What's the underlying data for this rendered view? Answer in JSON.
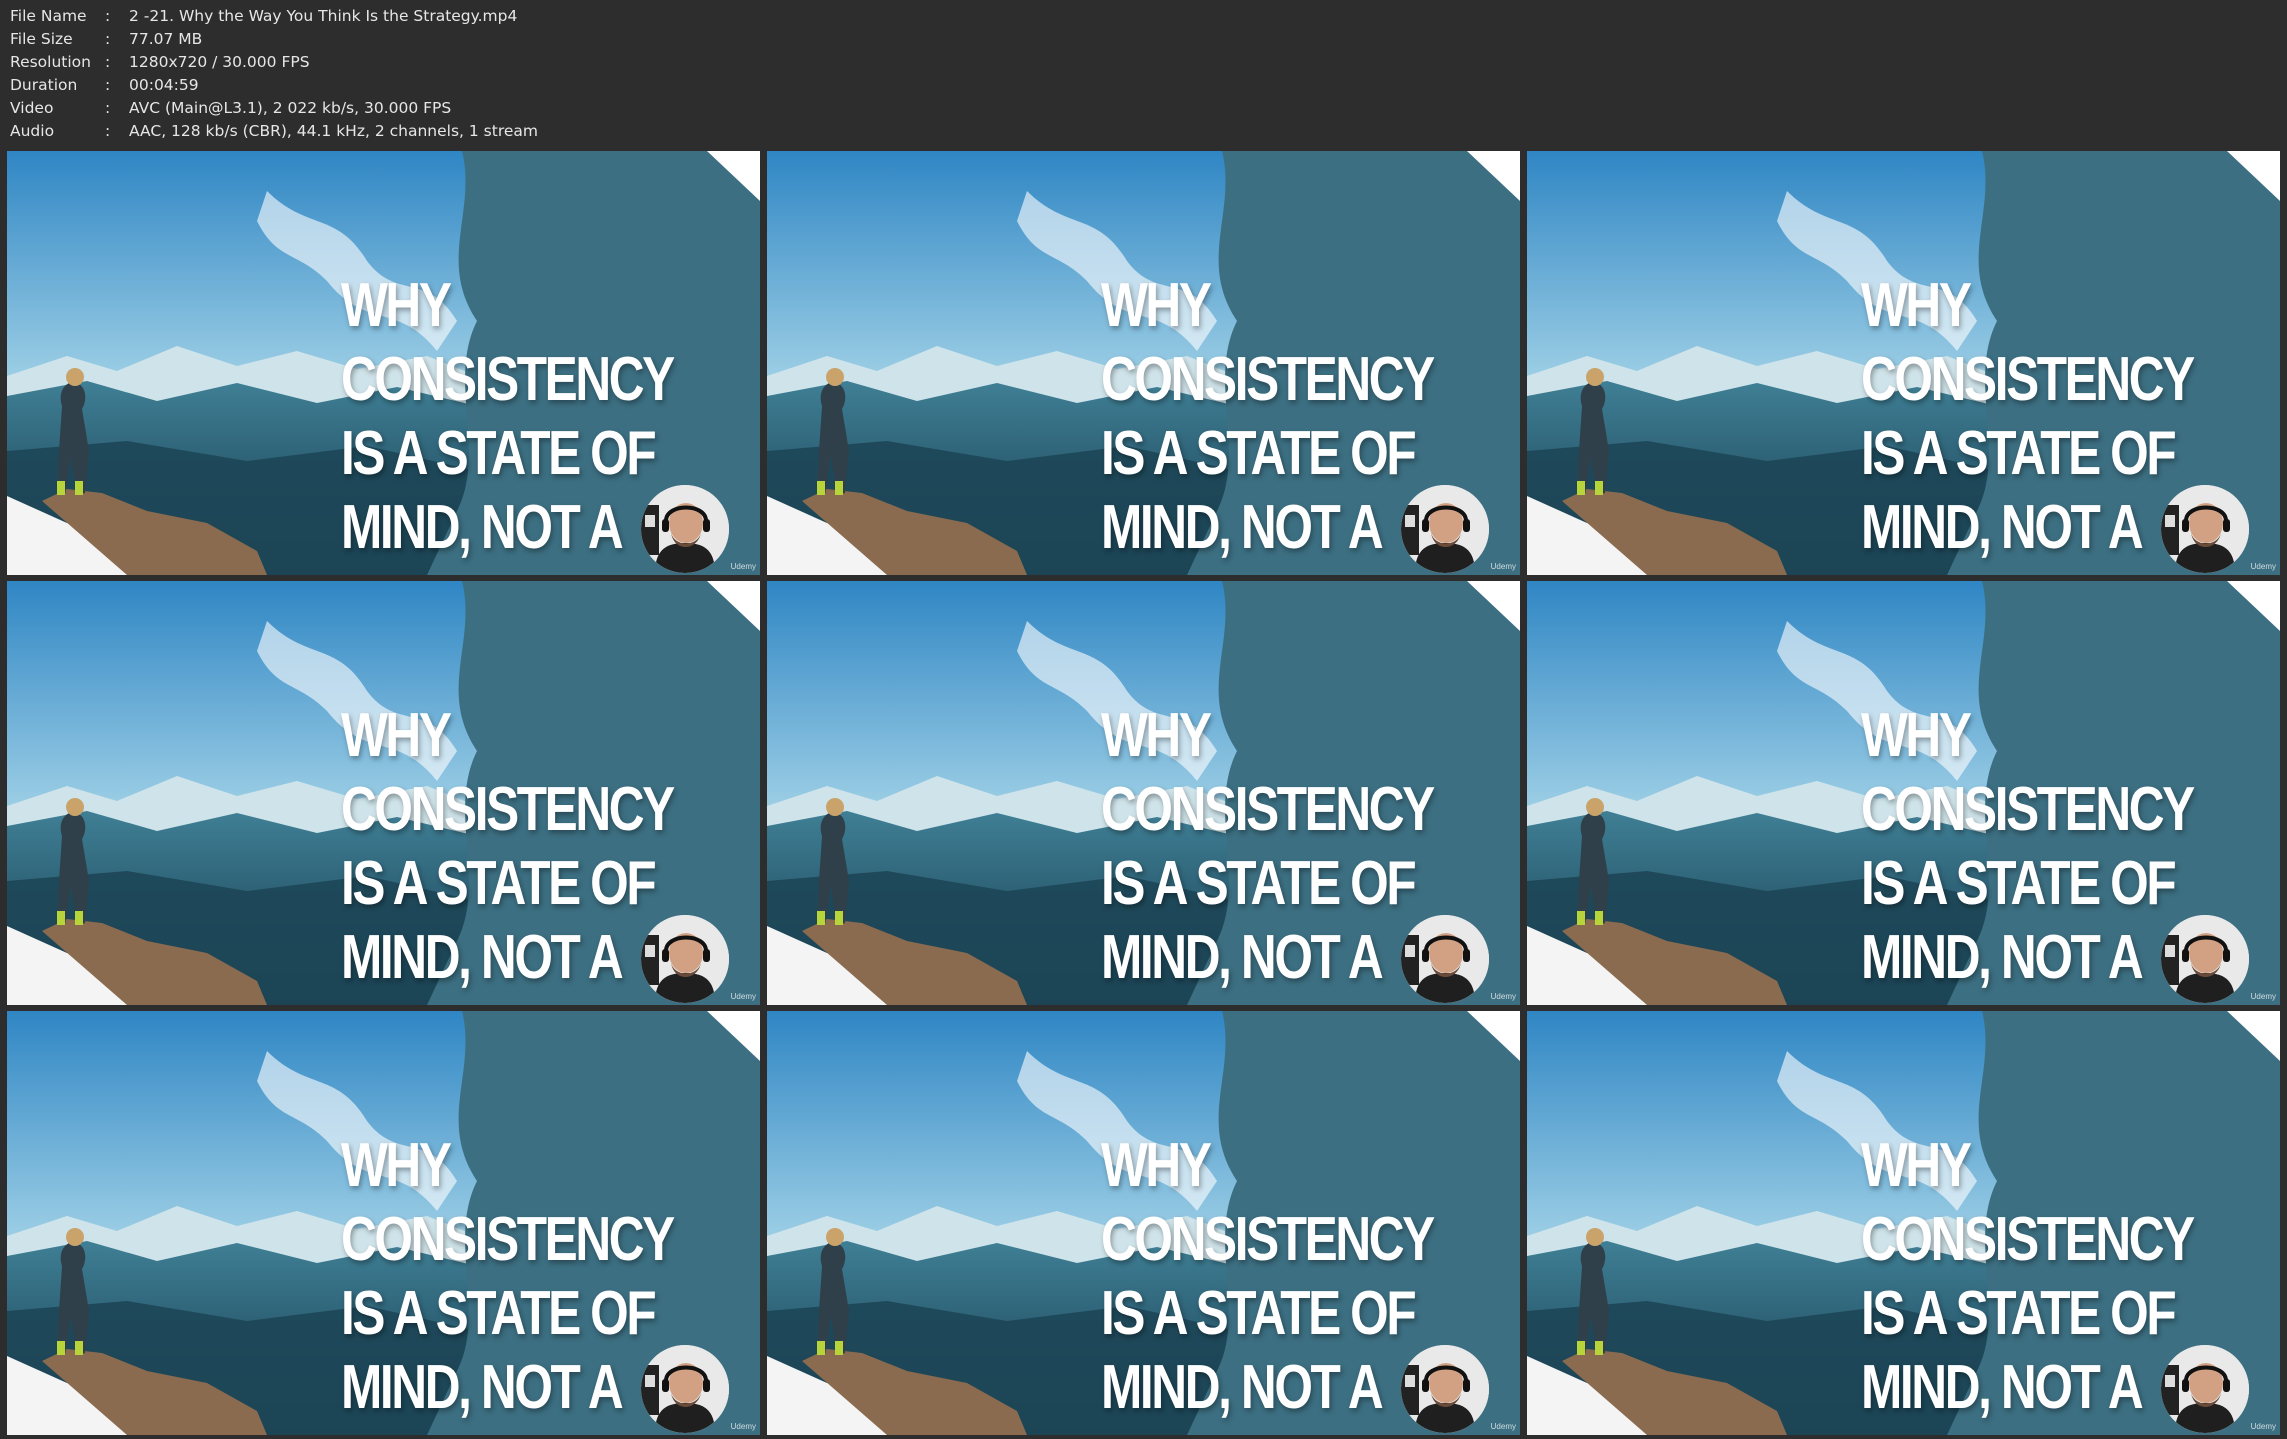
{
  "file_info": [
    {
      "label": "File Name",
      "value": "2 -21. Why the Way You Think Is the Strategy.mp4"
    },
    {
      "label": "File Size",
      "value": "77.07 MB"
    },
    {
      "label": "Resolution",
      "value": "1280x720 / 30.000 FPS"
    },
    {
      "label": "Duration",
      "value": "00:04:59"
    },
    {
      "label": "Video",
      "value": "AVC (Main@L3.1), 2 022 kb/s, 30.000 FPS"
    },
    {
      "label": "Audio",
      "value": "AAC, 128 kb/s (CBR), 44.1 kHz, 2 channels, 1 stream"
    }
  ],
  "separator": ":",
  "slide": {
    "title": "WHY CONSISTENCY\nIS A STATE OF\nMIND, NOT A\nSTRATEGY",
    "logo_text": "Udemy"
  },
  "thumbnail_count": 9,
  "colors": {
    "background": "#2d2d2d",
    "panel": "#2f6e86",
    "text": "#ffffff"
  }
}
